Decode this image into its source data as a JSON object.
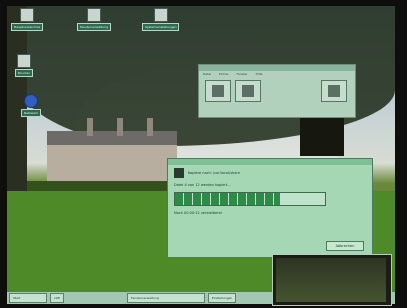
{
  "desktop": {
    "icons": [
      {
        "label": "Hauptverzeichnis",
        "type": "folder"
      },
      {
        "label": "Fensterverwaltung",
        "type": "folder"
      },
      {
        "label": "Systemeinstellungen",
        "type": "folder"
      },
      {
        "label": "Drucker",
        "type": "printer"
      },
      {
        "label": "Netzwerk",
        "type": "globe"
      }
    ]
  },
  "explorer": {
    "menu": [
      "Datei",
      "Extras",
      "Fenster",
      "Hilfe"
    ],
    "tool_icons": [
      "brush-icon",
      "window-icon",
      "tool-icon"
    ]
  },
  "dialog": {
    "title_text": "Kopiere nach: /usr/local/share",
    "line1": "Datei 4 von 12 werden kopiert...",
    "line2": "Noch 00:00:12 verbleibend",
    "progress": 0.7,
    "cancel_label": "Abbrechen"
  },
  "taskbar": {
    "start_label": "Start",
    "item1": "LDE",
    "item2": "Fensterverwaltung",
    "item3": "Einstellungen"
  }
}
